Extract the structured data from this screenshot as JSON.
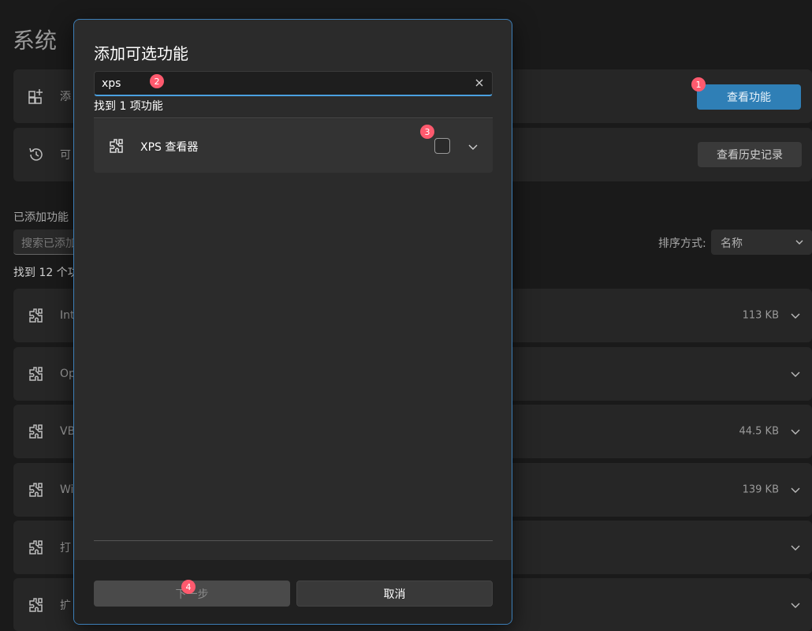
{
  "background": {
    "title": "系统",
    "add_card_label": "添",
    "view_features_button": "查看功能",
    "history_card_label": "可",
    "view_history_button": "查看历史记录",
    "added_features_heading": "已添加功能",
    "search_placeholder": "搜索已添加",
    "sort_label": "排序方式:",
    "sort_value": "名称",
    "found_count": "找到 12 个功",
    "features": [
      {
        "label": "Int",
        "size": "113 KB"
      },
      {
        "label": "Op",
        "size": ""
      },
      {
        "label": "VB",
        "size": "44.5 KB"
      },
      {
        "label": "Wi",
        "size": "139 KB"
      },
      {
        "label": "打",
        "size": ""
      },
      {
        "label": "扩",
        "size": ""
      }
    ]
  },
  "dialog": {
    "title": "添加可选功能",
    "search_value": "xps",
    "found_text": "找到 1 项功能",
    "result": {
      "name": "XPS 查看器"
    },
    "next_button": "下一步",
    "cancel_button": "取消"
  },
  "badges": [
    "1",
    "2",
    "3",
    "4"
  ],
  "colors": {
    "accent": "#2f7fb6",
    "dialog_border": "#3d7fb8",
    "badge": "#ff5a6e"
  }
}
